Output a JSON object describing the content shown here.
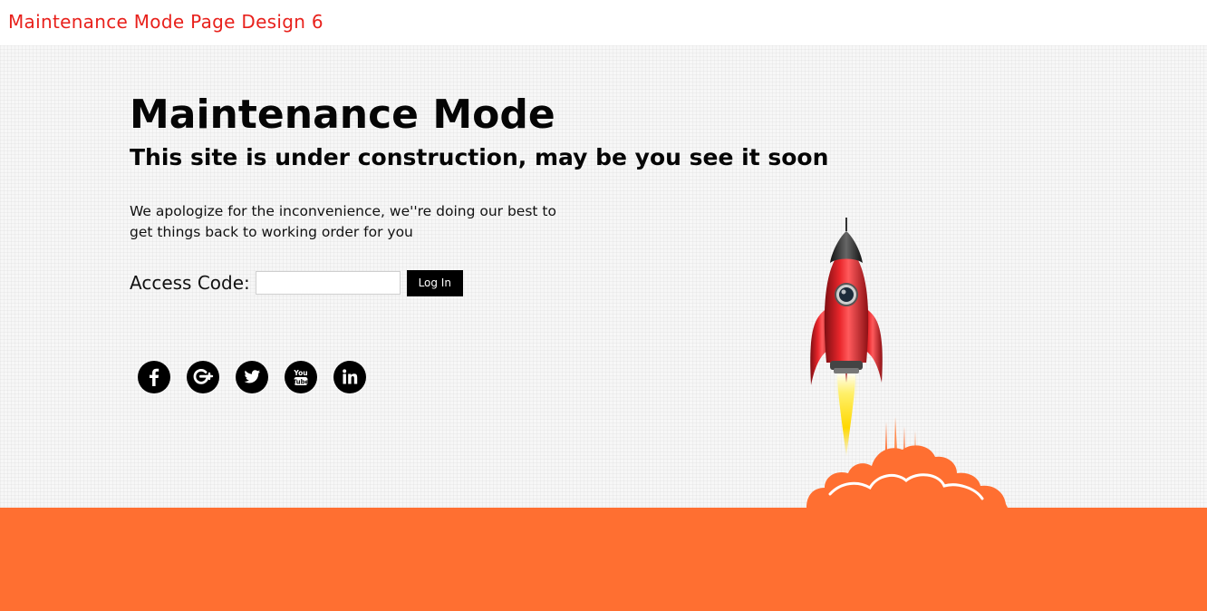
{
  "page": {
    "title": "Maintenance Mode Page Design 6"
  },
  "content": {
    "heading": "Maintenance Mode",
    "subheading": "This site is under construction, may be you see it soon",
    "message": "We apologize for the inconvenience, we''re doing our best to get things back to working order for you",
    "access_label": "Access Code:",
    "access_value": "",
    "login_label": "Log In"
  },
  "social": [
    {
      "icon": "facebook-icon"
    },
    {
      "icon": "google-plus-icon"
    },
    {
      "icon": "twitter-icon"
    },
    {
      "icon": "youtube-icon",
      "text_top": "You",
      "text_bottom": "Tube"
    },
    {
      "icon": "linkedin-icon"
    }
  ],
  "colors": {
    "title": "#e8211c",
    "footer": "#ff6f31",
    "text": "#050505",
    "button": "#000000"
  }
}
